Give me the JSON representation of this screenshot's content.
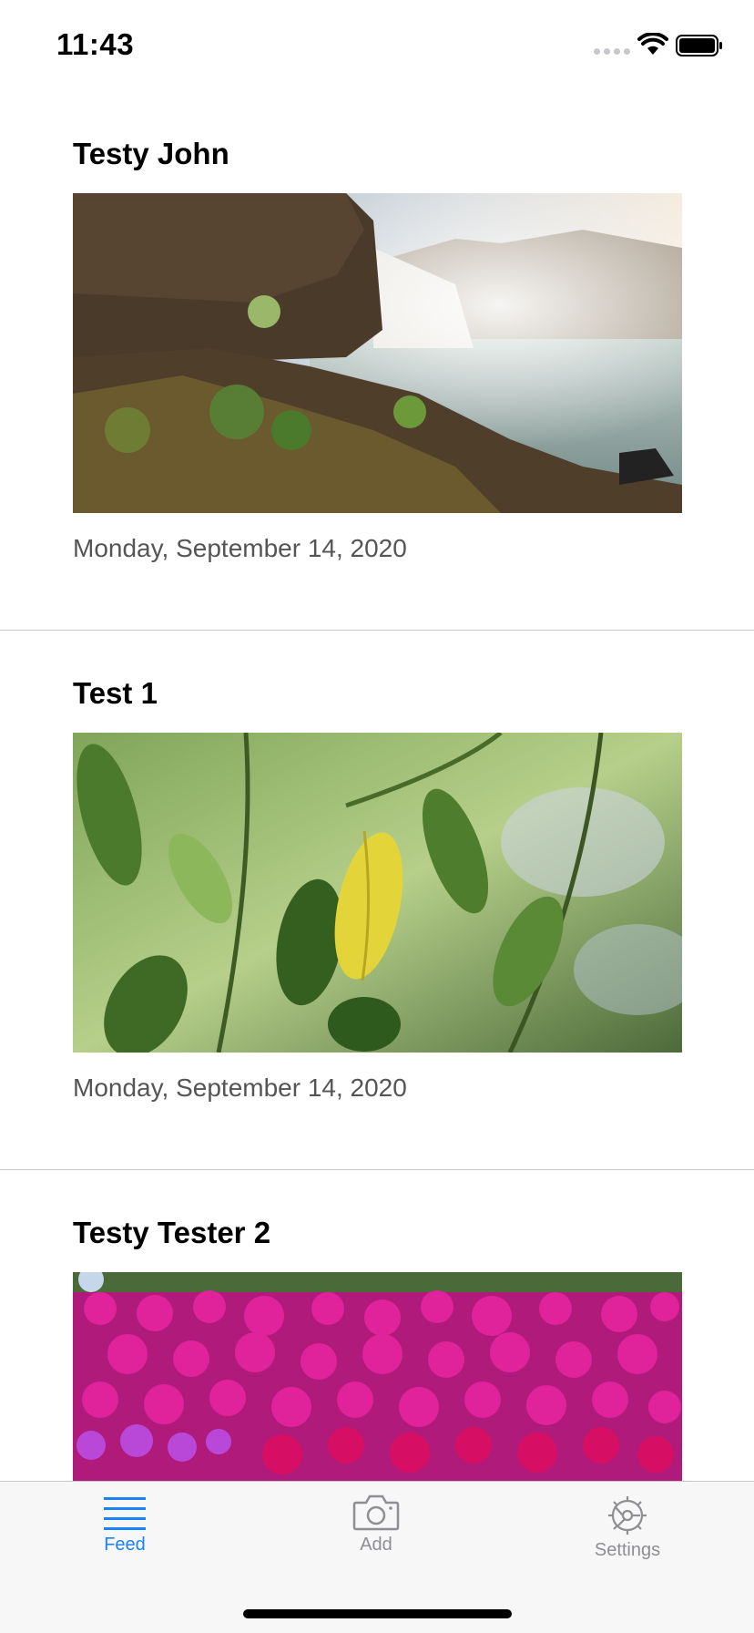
{
  "status_bar": {
    "time": "11:43"
  },
  "posts": [
    {
      "title": "Testy John",
      "date": "Monday, September 14, 2020",
      "image": "waterfall-photo"
    },
    {
      "title": "Test 1",
      "date": "Monday, September 14, 2020",
      "image": "lemon-leaves-photo"
    },
    {
      "title": "Testy Tester 2",
      "date": "",
      "image": "pink-flowers-photo"
    }
  ],
  "tab_bar": {
    "feed_label": "Feed",
    "add_label": "Add",
    "settings_label": "Settings",
    "active": "Feed"
  },
  "colors": {
    "accent": "#1a82f7",
    "inactive": "#8e8e93"
  }
}
